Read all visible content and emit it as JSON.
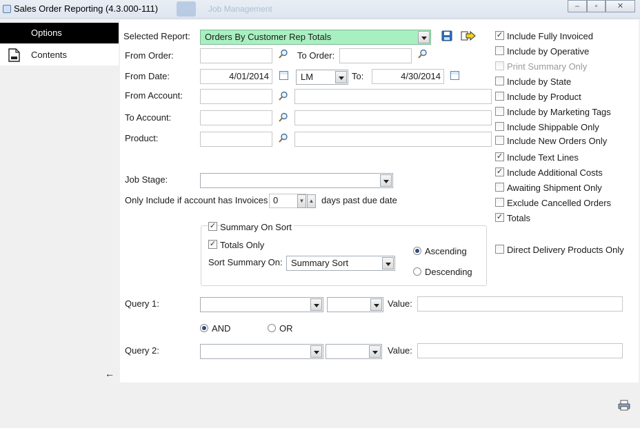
{
  "window": {
    "title": "Sales Order Reporting (4.3.000-111)",
    "background_tab": "Job Management",
    "buttons": [
      "–",
      "▫",
      "✕"
    ]
  },
  "sidebar": {
    "items": [
      {
        "label": "Options",
        "active": true
      },
      {
        "label": "Contents",
        "active": false
      }
    ],
    "collapse_glyph": "←"
  },
  "form": {
    "selected_report_label": "Selected Report:",
    "selected_report_value": "Orders By Customer Rep Totals",
    "from_order_label": "From Order:",
    "from_order_value": "",
    "to_order_label": "To Order:",
    "to_order_value": "",
    "from_date_label": "From Date:",
    "from_date_value": "4/01/2014",
    "period_value": "LM",
    "to_label": "To:",
    "to_date_value": "4/30/2014",
    "from_account_label": "From Account:",
    "to_account_label": "To Account:",
    "product_label": "Product:",
    "job_stage_label": "Job Stage:",
    "job_stage_value": "",
    "invoices_label": "Only Include if account has Invoices",
    "invoices_days_value": "0",
    "invoices_suffix": "days past due date"
  },
  "summary_group": {
    "summary_on_sort_label": "Summary On Sort",
    "summary_on_sort_checked": true,
    "totals_only_label": "Totals Only",
    "totals_only_checked": true,
    "sort_summary_on_label": "Sort Summary On:",
    "sort_summary_on_value": "Summary Sort",
    "ascending_label": "Ascending",
    "descending_label": "Descending",
    "sort_direction": "Ascending"
  },
  "queries": {
    "query1_label": "Query 1:",
    "query2_label": "Query 2:",
    "value_label": "Value:",
    "and_label": "AND",
    "or_label": "OR",
    "logic": "AND"
  },
  "options": [
    {
      "label": "Include Fully Invoiced",
      "checked": true,
      "enabled": true
    },
    {
      "label": "Include by Operative",
      "checked": false,
      "enabled": true
    },
    {
      "label": "Print Summary Only",
      "checked": false,
      "enabled": false
    },
    {
      "label": "Include by State",
      "checked": false,
      "enabled": true
    },
    {
      "label": "Include by Product",
      "checked": false,
      "enabled": true
    },
    {
      "label": "Include by Marketing Tags",
      "checked": false,
      "enabled": true
    },
    {
      "label": "Include Shippable Only",
      "checked": false,
      "enabled": true
    },
    {
      "label": "Include New Orders Only",
      "checked": false,
      "enabled": true
    },
    {
      "label": "Include Text Lines",
      "checked": true,
      "enabled": true
    },
    {
      "label": "Include Additional Costs",
      "checked": true,
      "enabled": true
    },
    {
      "label": "Awaiting Shipment Only",
      "checked": false,
      "enabled": true
    },
    {
      "label": "Exclude Cancelled Orders",
      "checked": false,
      "enabled": true
    },
    {
      "label": "Totals",
      "checked": true,
      "enabled": true
    }
  ],
  "direct_delivery": {
    "label": "Direct Delivery Products Only",
    "checked": false
  },
  "check_glyph": "✓",
  "colors": {
    "report_combo": "#a8f0c0",
    "sidebar_active": "#000000"
  },
  "icons": {
    "save": "save-icon",
    "export": "export-icon",
    "search": "magnifier-icon",
    "calendar": "calendar-icon",
    "print": "printer-icon"
  }
}
